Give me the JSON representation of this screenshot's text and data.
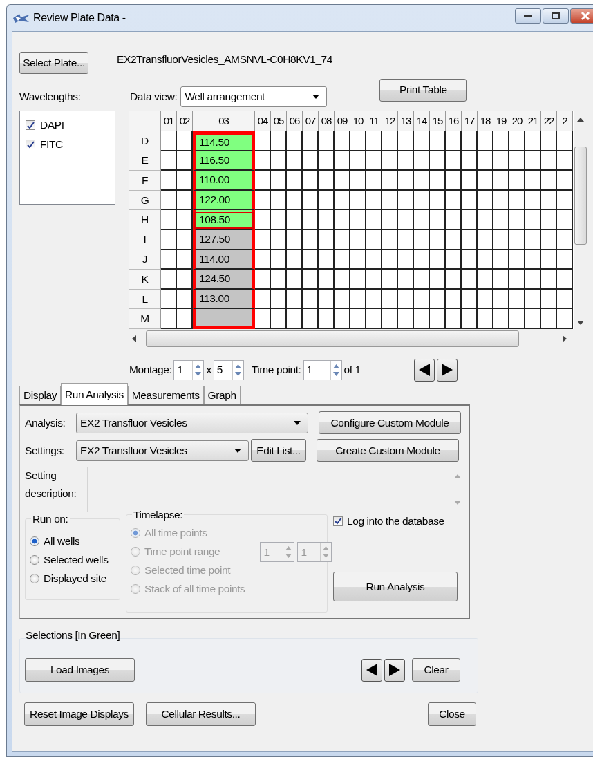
{
  "window": {
    "title": "Review Plate Data -"
  },
  "select_plate_button": "Select Plate...",
  "plate_name": "EX2TransfluorVesicles_AMSNVL-C0H8KV1_74",
  "wavelengths": {
    "label": "Wavelengths:",
    "items": [
      {
        "name": "DAPI",
        "checked": true
      },
      {
        "name": "FITC",
        "checked": true
      }
    ]
  },
  "data_view": {
    "label": "Data view:",
    "value": "Well arrangement"
  },
  "print_table_button": "Print Table",
  "grid": {
    "highlight_frame": true,
    "columns": [
      {
        "label": "01",
        "kind": "empty"
      },
      {
        "label": "02",
        "kind": "empty"
      },
      {
        "label": "03",
        "kind": "data"
      },
      {
        "label": "04",
        "kind": "empty"
      },
      {
        "label": "05",
        "kind": "empty"
      },
      {
        "label": "06",
        "kind": "empty"
      },
      {
        "label": "07",
        "kind": "empty"
      },
      {
        "label": "08",
        "kind": "empty"
      },
      {
        "label": "09",
        "kind": "empty"
      },
      {
        "label": "10",
        "kind": "empty"
      },
      {
        "label": "11",
        "kind": "empty"
      },
      {
        "label": "12",
        "kind": "empty"
      },
      {
        "label": "13",
        "kind": "empty"
      },
      {
        "label": "14",
        "kind": "empty"
      },
      {
        "label": "15",
        "kind": "empty"
      },
      {
        "label": "16",
        "kind": "empty"
      },
      {
        "label": "17",
        "kind": "empty"
      },
      {
        "label": "18",
        "kind": "empty"
      },
      {
        "label": "19",
        "kind": "empty"
      },
      {
        "label": "20",
        "kind": "empty"
      },
      {
        "label": "21",
        "kind": "empty"
      },
      {
        "label": "22",
        "kind": "empty"
      },
      {
        "label": "2",
        "kind": "empty"
      }
    ],
    "rows": [
      {
        "label": "D",
        "value": "114.50",
        "selected": true,
        "current": false
      },
      {
        "label": "E",
        "value": "116.50",
        "selected": true,
        "current": false
      },
      {
        "label": "F",
        "value": "110.00",
        "selected": true,
        "current": false
      },
      {
        "label": "G",
        "value": "122.00",
        "selected": true,
        "current": false
      },
      {
        "label": "H",
        "value": "108.50",
        "selected": true,
        "current": true
      },
      {
        "label": "I",
        "value": "127.50",
        "selected": false,
        "current": false
      },
      {
        "label": "J",
        "value": "114.00",
        "selected": false,
        "current": false
      },
      {
        "label": "K",
        "value": "124.50",
        "selected": false,
        "current": false
      },
      {
        "label": "L",
        "value": "113.00",
        "selected": false,
        "current": false
      },
      {
        "label": "M",
        "selected": false,
        "current": false
      }
    ]
  },
  "montage": {
    "label": "Montage:",
    "rows": "1",
    "x": "x",
    "cols": "5",
    "time_label": "Time point:",
    "time": "1",
    "of": "of 1"
  },
  "tabs": [
    {
      "label": "Display",
      "selected": false
    },
    {
      "label": "Run Analysis",
      "selected": true
    },
    {
      "label": "Measurements",
      "selected": false
    },
    {
      "label": "Graph",
      "selected": false
    }
  ],
  "analysis": {
    "label": "Analysis:",
    "value": "EX2 Transfluor Vesicles"
  },
  "settings": {
    "label": "Settings:",
    "value": "EX2 Transfluor Vesicles",
    "edit_button": "Edit List..."
  },
  "configure_button": "Configure Custom Module",
  "create_button": "Create Custom Module",
  "description_label": "Setting description:",
  "run_on": {
    "title": "Run on:",
    "options": [
      {
        "label": "All wells",
        "selected": true
      },
      {
        "label": "Selected wells",
        "selected": false
      },
      {
        "label": "Displayed site",
        "selected": false
      }
    ]
  },
  "timelapse": {
    "title": "Timelapse:",
    "disabled": true,
    "options": [
      {
        "label": "All time points",
        "selected": true
      },
      {
        "label": "Time point range",
        "selected": false
      },
      {
        "label": "Selected time point",
        "selected": false
      },
      {
        "label": "Stack of all time points",
        "selected": false
      }
    ],
    "range_from": "1",
    "range_to": "1"
  },
  "log_db": {
    "label": "Log into the database",
    "checked": true
  },
  "run_button": "Run Analysis",
  "selections": {
    "title": "Selections [In Green]",
    "load_button": "Load Images",
    "clear_button": "Clear"
  },
  "bottom_buttons": {
    "reset": "Reset Image Displays",
    "cellular": "Cellular Results...",
    "close": "Close"
  }
}
